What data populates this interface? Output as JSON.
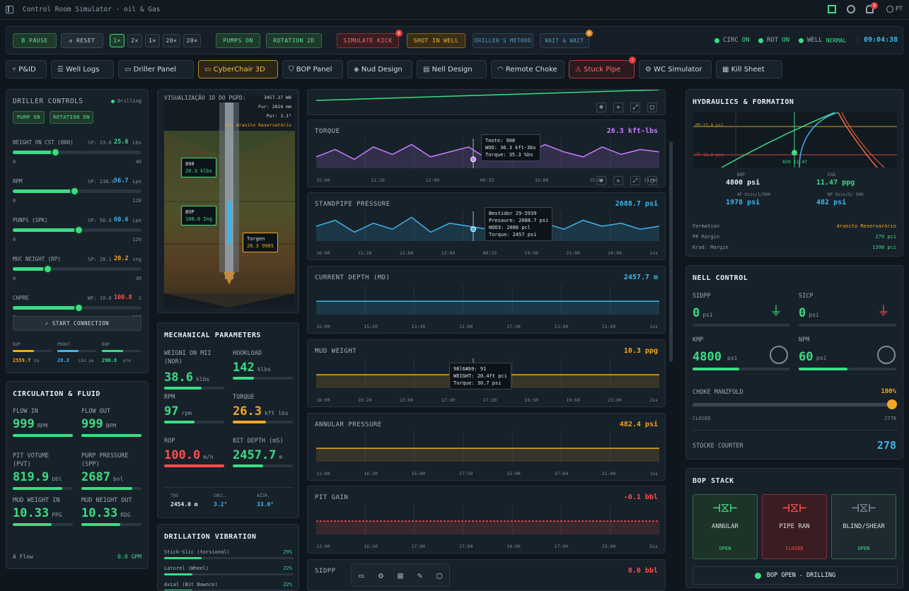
{
  "app": {
    "title": "Control Room Simulator - oil & Gas",
    "user": "PT",
    "notif_count": "9"
  },
  "controls": {
    "pause": "B PAUSE",
    "reset": "↺ RESET",
    "speeds": [
      "1×",
      "2×",
      "1×",
      "20×",
      "20×"
    ],
    "pumps": "PUMPS ON",
    "rotation": "ROTATION 2D",
    "simulate_kick": "SIMULATE KICK",
    "shut_in": "SHUT IN WELL",
    "drillers_method": "DRILLER'S METHOD",
    "wait_weight": "WAIT & WAIT",
    "kick_badge": "0",
    "wait_badge": "0"
  },
  "status": {
    "circ_label": "CIRC",
    "circ_val": "ON",
    "rot_label": "ROT",
    "rot_val": "ON",
    "well_label": "WELL",
    "well_val": "NERMAL",
    "clock": "09:04:38"
  },
  "tabs": [
    "P&ID",
    "Well Logs",
    "Driller Panel",
    "CyberChair 3D",
    "BOP Panel",
    "Nud Design",
    "Nell Design",
    "Remote Choke",
    "Stuck Pipe",
    "WC Simulator",
    "Kill Sheet"
  ],
  "tab_badge": "!",
  "driller": {
    "title": "DRILLER CONTROLS",
    "status": "Drilling",
    "pump_btn": "PUMP ON",
    "rot_btn": "ROTATION ON",
    "sliders": [
      {
        "label": "BEIGHT ON CST (000)",
        "sp": "SP: 23.8",
        "val": "25.6",
        "unit": "Lbs",
        "min": "0",
        "max": "40",
        "fill": 0.33,
        "color": "#3ddc84"
      },
      {
        "label": "RPM",
        "sp": "SP: 238.9",
        "val": "56.7",
        "unit": "Lpe",
        "min": "0",
        "max": "120",
        "fill": 0.48,
        "color": "#3fb6ea"
      },
      {
        "label": "PUNPS (SPK)",
        "sp": "SP: 58.8",
        "val": "60.6",
        "unit": "Lpe",
        "min": "0",
        "max": "120",
        "fill": 0.51,
        "color": "#3fb6ea"
      },
      {
        "label": "MUC NEIGHT (RP)",
        "sp": "SP: 28.1",
        "val": "20.2",
        "unit": "ing",
        "min": "0",
        "max": "30",
        "fill": 0.27,
        "color": "#f5a623"
      },
      {
        "label": "CHPRE",
        "sp": "WF: 10.0",
        "val": "100.8",
        "unit": "S",
        "min": "0",
        "max": "300",
        "fill": 0.51,
        "color": "#ff4d4d"
      }
    ],
    "connection_btn": "✓ START CONNECTION",
    "mini": [
      {
        "label": "BOP",
        "val": "2559.7",
        "unit": "Ua",
        "color": "#f5a623"
      },
      {
        "label": "PROUT",
        "val": "28.3",
        "unit": "Lbs pe",
        "color": "#3fb6ea"
      },
      {
        "label": "BOP",
        "val": "290.8",
        "unit": "pre",
        "color": "#3ddc84"
      }
    ]
  },
  "circulation": {
    "title": "CIRCULATION & FLUID",
    "items": [
      {
        "label": "FLOW IN",
        "val": "999",
        "unit": "RPM",
        "fill": 1
      },
      {
        "label": "FLOW OUT",
        "val": "999",
        "unit": "BPM",
        "fill": 1
      },
      {
        "label": "PIT VOTUME\n(PVT)",
        "val": "819.9",
        "unit": "bbl",
        "fill": 0.82
      },
      {
        "label": "PURP PRESSURE\n(SPP)",
        "val": "2687",
        "unit": "bol",
        "fill": 0.85
      },
      {
        "label": "MUD WEIGHT IN",
        "val": "10.33",
        "unit": "PPG",
        "fill": 0.65
      },
      {
        "label": "MUD NEIGHT OUT",
        "val": "10.33",
        "unit": "RDG",
        "fill": 0.65
      }
    ],
    "aflow_label": "A Flow",
    "aflow_val": "0.0 GPM"
  },
  "viz": {
    "title": "VISUALIZAÇÃO 1D DO PGPD:",
    "info": [
      "3457.37 W8",
      "Fur: 2024 mm",
      "Pur: 3.1°",
      "Pe: Aranito Reservatório"
    ],
    "callouts": [
      {
        "t": "808",
        "v": "20.3 klbs"
      },
      {
        "t": "BOP",
        "v": "100.0 Ing"
      },
      {
        "t": "Torgen",
        "v": "26.3 9965"
      }
    ]
  },
  "mech": {
    "title": "MECHANICAL PARAMETERS",
    "items": [
      {
        "label": "WEIGNI ON MII\n(NOR)",
        "val": "38.6",
        "unit": "klbs",
        "color": "#3ddc84",
        "fill": 0.62
      },
      {
        "label": "HOOKLOAD",
        "val": "142",
        "unit": "klbs",
        "color": "#3ddc84",
        "fill": 0.35
      },
      {
        "label": "RPM",
        "val": "97",
        "unit": "rpm",
        "color": "#3ddc84",
        "fill": 0.5
      },
      {
        "label": "TORQUE",
        "val": "26.3",
        "unit": "kft lbs",
        "color": "#f5a623",
        "fill": 0.55
      },
      {
        "label": "ROP",
        "val": "100.0",
        "unit": "m/h",
        "color": "#ff4d4d",
        "fill": 1
      },
      {
        "label": "BIT DEPTH (mS)",
        "val": "2457.7",
        "unit": "m",
        "color": "#3ddc84",
        "fill": 0.5
      }
    ],
    "foot": [
      {
        "label": "TOD",
        "val": "2454.0 m"
      },
      {
        "label": "INCL.",
        "val": "3.2°"
      },
      {
        "label": "AZIM.",
        "val": "33.0°"
      }
    ]
  },
  "vibration": {
    "title": "DRILLATION VIBRATION",
    "items": [
      {
        "label": "Stick-Slic (torsional)",
        "val": "29%",
        "fill": 0.29
      },
      {
        "label": "Latorel (Wheel)",
        "val": "22%",
        "fill": 0.22
      },
      {
        "label": "Axial (Bit Bawnce)",
        "val": "22%",
        "fill": 0.22
      }
    ]
  },
  "charts": [
    {
      "title": "TORQUE",
      "value": "26.3 kft-lbs",
      "ticks": [
        "15:00",
        "11:20",
        "12:00",
        "00:33",
        "15:00",
        "15:00",
        "21:00"
      ],
      "tip": "Teote: 908\nWOO: 36.3 kft-3bs\nTorque: 35.3 %bs"
    },
    {
      "title": "STANDPIPE PRESSURE",
      "value": "2688.7 psi",
      "ticks": [
        "16:00",
        "11:20",
        "12:00",
        "13:00",
        "00:33",
        "19:00",
        "21:00",
        "24:00",
        "1ss"
      ],
      "tip": "Bestidor 29-5939\nPresaure: 2088.7 psi\nNOO3: 2080 pcl\nTorque: 2457 psi"
    },
    {
      "title": "CURRENT DEPTH (MD)",
      "value": "2457.7 m",
      "ticks": [
        "15:00",
        "15:20",
        "13:30",
        "12:00",
        "17:20",
        "13:40",
        "21:60",
        "1ss"
      ]
    },
    {
      "title": "MUD WEIGHT",
      "value": "10.3 ppg",
      "ticks": [
        "18:00",
        "16:20",
        "13:00",
        "17:30",
        "17:20",
        "18:50",
        "19:60",
        "21:00",
        "2ss"
      ],
      "tip": "98l6#b9: 91\nWEIGHT: 20.4ft pci\nTorque: 30.7 psi"
    },
    {
      "title": "ANNULAR PRESSURE",
      "value": "482.4 psi",
      "ticks": [
        "11:00",
        "16:30",
        "15:00",
        "17:50",
        "15:00",
        "37:60",
        "21:00",
        "1ss"
      ]
    },
    {
      "title": "PIT GAIN",
      "value": "-0.1 bbl",
      "ticks": [
        "13:00",
        "16:30",
        "17:00",
        "17:00",
        "14:00",
        "17:00",
        "23:00",
        "5ss"
      ]
    },
    {
      "title": "SIDPP",
      "value": "0.0 bbl"
    }
  ],
  "chart_data": {
    "type": "line",
    "series": [
      {
        "name": "TORQUE",
        "color": "#c77dff",
        "values": [
          26.1,
          26.4,
          26.0,
          26.5,
          26.2,
          26.6,
          26.1,
          26.3,
          26.5,
          26.0,
          26.4,
          26.2,
          26.6,
          26.3,
          26.1,
          26.5,
          26.2,
          26.4,
          26.3
        ]
      },
      {
        "name": "STANDPIPE PRESSURE",
        "color": "#3fb6ea",
        "values": [
          2688,
          2690,
          2686,
          2689,
          2687,
          2691,
          2686,
          2689,
          2688,
          2687,
          2690,
          2688,
          2689,
          2687,
          2690,
          2688,
          2689,
          2687,
          2688
        ]
      },
      {
        "name": "CURRENT DEPTH (MD)",
        "color": "#3fb6ea",
        "values": [
          2457.7,
          2457.7,
          2457.7,
          2457.7,
          2457.7,
          2457.7,
          2457.7,
          2457.7
        ]
      },
      {
        "name": "MUD WEIGHT",
        "color": "#f5a623",
        "values": [
          10.3,
          10.3,
          10.3,
          10.3,
          10.3,
          10.3,
          10.3,
          10.3
        ]
      },
      {
        "name": "ANNULAR PRESSURE",
        "color": "#f5a623",
        "values": [
          482.4,
          482.4,
          482.4,
          482.4,
          482.4,
          482.4,
          482.4,
          482.4
        ]
      },
      {
        "name": "PIT GAIN",
        "color": "#ff4d4d",
        "values": [
          -0.1,
          -0.1,
          -0.1,
          -0.1,
          -0.1,
          -0.1,
          -0.1,
          -0.1
        ]
      }
    ]
  },
  "hydraulics": {
    "title": "HYDRAULICS & FORMATION",
    "pp": "PP-15.8 psi",
    "fp": "FP-11.0 psi",
    "point": "820 11.47",
    "stats": [
      {
        "label": "BOP",
        "val": "4800 psi",
        "color": "#e8eef2"
      },
      {
        "label": "ESD",
        "val": "11.47 ppg",
        "color": "#3ddc84"
      },
      {
        "label": "AF Hzzs/1/500",
        "val": "1978 psi",
        "color": "#3fb6ea"
      },
      {
        "label": "BP Hzzs/5/ 500",
        "val": "482 psi",
        "color": "#3fb6ea"
      }
    ],
    "rows": [
      {
        "label": "Formation",
        "val": "Aranito Reservarório",
        "color": "#f5a623"
      },
      {
        "label": "PP Rargin",
        "val": "279 pci",
        "color": "#3ddc84"
      },
      {
        "label": "Krad. Margin",
        "val": "1390 pci",
        "color": "#3ddc84"
      }
    ]
  },
  "well_control": {
    "title": "NELL CONTROL",
    "sidpp_label": "SIDPP",
    "sidpp": "0",
    "sicp_label": "SICP",
    "sicp": "0",
    "psi": "psi",
    "kmp_label": "KMP",
    "kmp": "4800",
    "npm_label": "NPM",
    "npm": "60",
    "choke_label": "CHOKE MANZFOLD",
    "choke_val": "100%",
    "closed": "CLOSED",
    "choke_num": "2778",
    "choke_fill": 1,
    "stroke_label": "STOCKE COURTER",
    "stroke": "278"
  },
  "bop": {
    "title": "BOP STACK",
    "items": [
      {
        "label": "ANNULAR",
        "state": "OPEN"
      },
      {
        "label": "PIPE RAN",
        "state": "CLOSED"
      },
      {
        "label": "BLIND/SHEAR",
        "state": "OPEN"
      }
    ],
    "status": "BOP OPEN - DRILLING"
  }
}
